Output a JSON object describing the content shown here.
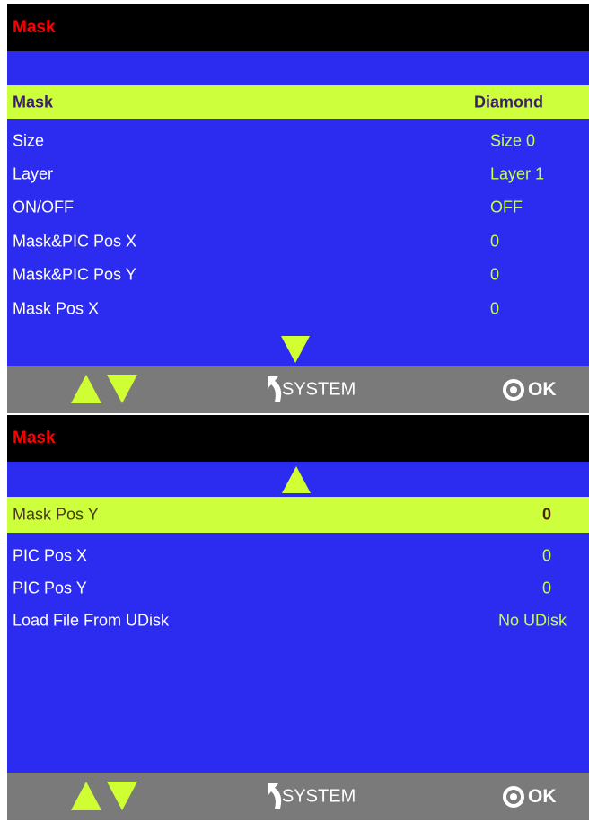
{
  "top_panel": {
    "title": "Mask",
    "rows": [
      {
        "label": "Mask",
        "value": "Diamond"
      },
      {
        "label": "Size",
        "value": "Size 0"
      },
      {
        "label": "Layer",
        "value": "Layer 1"
      },
      {
        "label": "ON/OFF",
        "value": "OFF"
      },
      {
        "label": "Mask&PIC Pos X",
        "value": "0"
      },
      {
        "label": "Mask&PIC Pos Y",
        "value": "0"
      },
      {
        "label": "Mask Pos X",
        "value": "0"
      }
    ],
    "footer": {
      "system_label": "SYSTEM",
      "ok_label": "OK"
    }
  },
  "bottom_panel": {
    "title": "Mask",
    "rows": [
      {
        "label": "Mask Pos Y",
        "value": "0"
      },
      {
        "label": "PIC Pos X",
        "value": "0"
      },
      {
        "label": "PIC Pos Y",
        "value": "0"
      },
      {
        "label": "Load File From UDisk",
        "value": "No UDisk"
      }
    ],
    "footer": {
      "system_label": "SYSTEM",
      "ok_label": "OK"
    }
  },
  "colors": {
    "panel_bg": "#2c2cf0",
    "highlight": "#cdff3c",
    "title_text": "#ff0000",
    "value_text": "#c5ff4a",
    "footer_bg": "#7a7a7a"
  },
  "icons": [
    "up-arrow-icon",
    "down-arrow-icon",
    "back-arrow-icon",
    "ok-target-icon"
  ]
}
